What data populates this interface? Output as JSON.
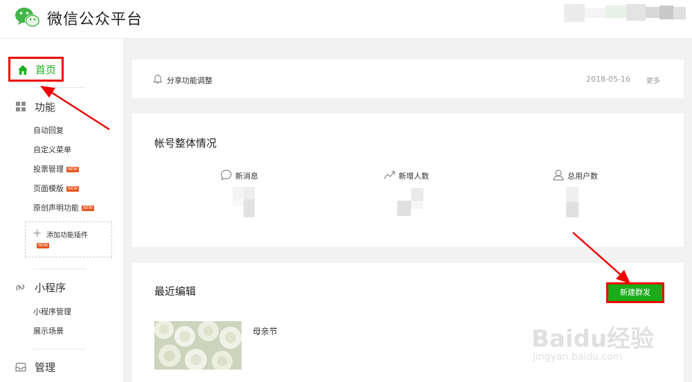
{
  "header": {
    "brand": "微信公众平台"
  },
  "sidebar": {
    "home": "首页",
    "features": {
      "title": "功能",
      "items": [
        {
          "label": "自动回复",
          "tag": ""
        },
        {
          "label": "自定义菜单",
          "tag": ""
        },
        {
          "label": "投票管理",
          "tag": "NEW"
        },
        {
          "label": "页面模版",
          "tag": "NEW"
        },
        {
          "label": "原创声明功能",
          "tag": "NEW"
        }
      ],
      "add_plugin": "添加功能插件",
      "add_plugin_tag": "NEW"
    },
    "miniprogram": {
      "title": "小程序",
      "items": [
        {
          "label": "小程序管理"
        },
        {
          "label": "展示场景"
        }
      ]
    },
    "manage": {
      "title": "管理"
    }
  },
  "notice": {
    "text": "分享功能调整",
    "date": "2018-05-16",
    "more": "更多"
  },
  "overview": {
    "title": "帐号整体情况",
    "stats": [
      {
        "label": "新消息",
        "icon": "chat-bubble-icon"
      },
      {
        "label": "新增人数",
        "icon": "trend-up-icon"
      },
      {
        "label": "总用户数",
        "icon": "user-icon"
      }
    ]
  },
  "recent": {
    "title": "最近编辑",
    "new_button": "新建群发",
    "articles": [
      {
        "title": "母亲节"
      }
    ]
  },
  "watermark": {
    "main": "Baidu经验",
    "url": "jingyan.baidu.com"
  },
  "colors": {
    "accent": "#1aad19",
    "highlight": "#e00000",
    "new_tag": "#e8541e"
  }
}
